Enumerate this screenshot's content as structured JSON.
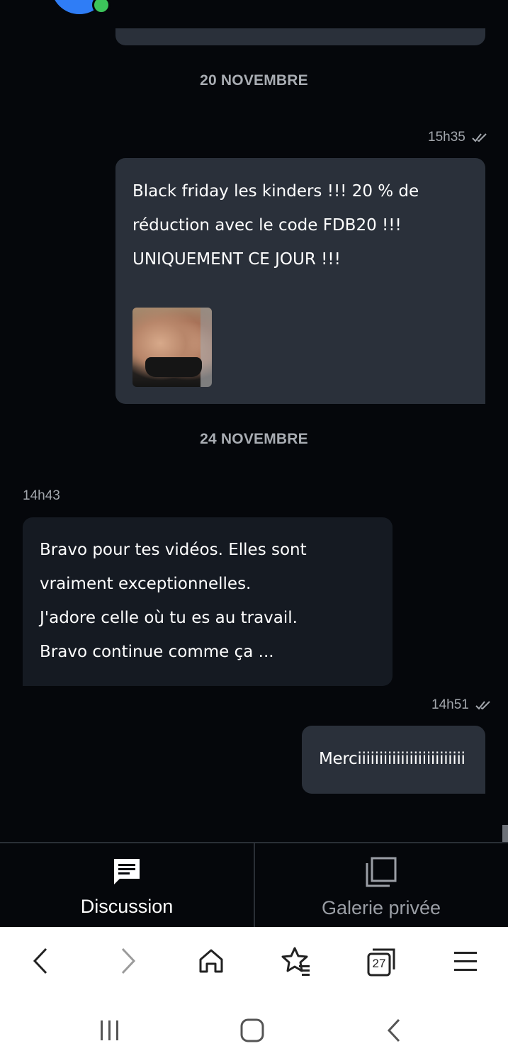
{
  "chat": {
    "separators": [
      "20 NOVEMBRE",
      "24 NOVEMBRE"
    ],
    "messages": [
      {
        "direction": "outgoing",
        "time": "15h35",
        "lines": [
          "Black friday les kinders !!! 20 % de",
          "réduction avec le code FDB20 !!!",
          "UNIQUEMENT CE JOUR !!!"
        ],
        "has_image": true
      },
      {
        "direction": "incoming",
        "time": "14h43",
        "lines": [
          "Bravo pour tes vidéos. Elles sont",
          "vraiment exceptionnelles.",
          "J'adore celle où tu es au travail.",
          "Bravo continue comme ça ..."
        ]
      },
      {
        "direction": "outgoing",
        "time": "14h51",
        "lines": [
          "Merciiiiiiiiiiiiiiiiiiiiiiiii"
        ]
      }
    ]
  },
  "tabs": {
    "discussion": "Discussion",
    "gallery": "Galerie privée"
  },
  "browser": {
    "tab_count": "27"
  },
  "colors": {
    "background": "#05070b",
    "outgoing_bubble": "#2a303a",
    "incoming_bubble": "#151a22",
    "online": "#3cc35a",
    "avatar": "#2f7df6"
  },
  "icons": {
    "read_receipt": "double-check-icon",
    "discussion_tab": "message-icon",
    "gallery_tab": "gallery-icon",
    "back": "chevron-left-icon",
    "forward": "chevron-right-icon",
    "home": "home-icon",
    "bookmarks": "star-list-icon",
    "tabs": "tabs-icon",
    "menu": "menu-icon"
  }
}
